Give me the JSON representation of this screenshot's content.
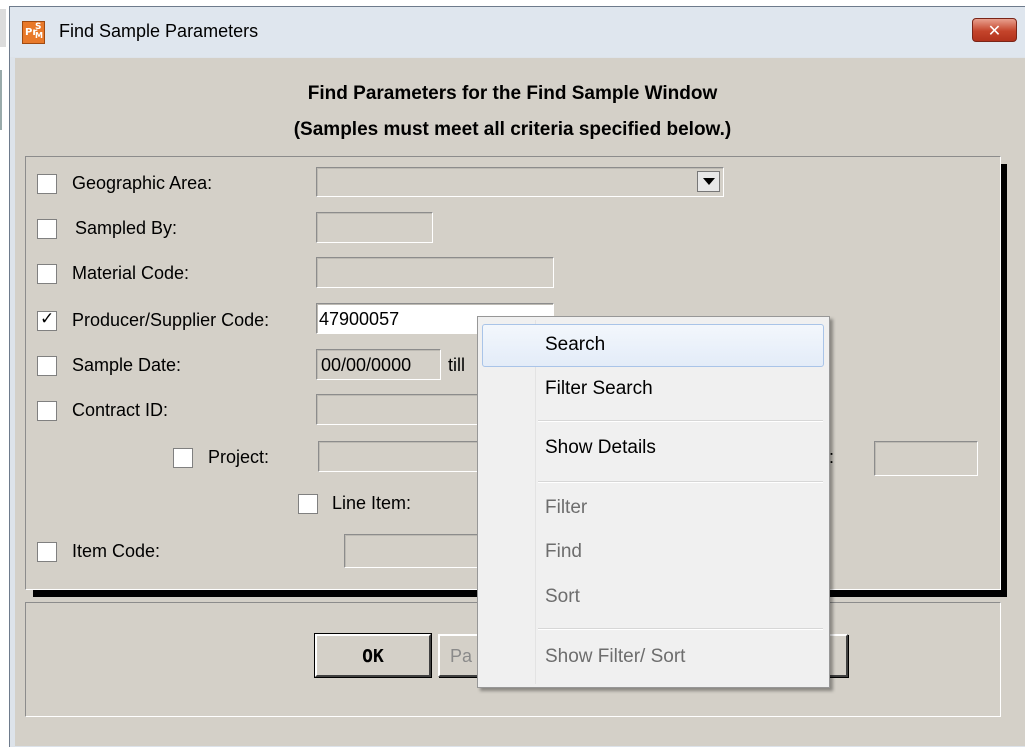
{
  "window": {
    "title": "Find Sample Parameters",
    "close_glyph": "✕",
    "icon": {
      "name": "prism-app-icon",
      "letters": [
        "Pr",
        "S",
        "M"
      ]
    }
  },
  "heading": {
    "line1": "Find Parameters for the Find Sample Window",
    "line2": "(Samples must meet all criteria specified below.)"
  },
  "criteria": {
    "geographic_area": {
      "label": "Geographic Area:",
      "checked": false,
      "value": ""
    },
    "sampled_by": {
      "label": "Sampled By:",
      "checked": false,
      "value": ""
    },
    "material_code": {
      "label": "Material Code:",
      "checked": false,
      "value": ""
    },
    "producer_supplier_code": {
      "label": "Producer/Supplier Code:",
      "checked": true,
      "value": "47900057"
    },
    "sample_date": {
      "label": "Sample Date:",
      "checked": false,
      "from": "00/00/0000",
      "till_label": "till"
    },
    "contract_id": {
      "label": "Contract ID:",
      "checked": false,
      "value": ""
    },
    "project": {
      "label": "Project:",
      "checked": false,
      "value": "",
      "partial_label": ":"
    },
    "line_item": {
      "label": "Line Item:",
      "checked": false
    },
    "item_code": {
      "label": "Item Code:",
      "checked": false,
      "value": ""
    }
  },
  "buttons": {
    "ok": "OK",
    "partial": "Pa"
  },
  "context_menu": {
    "items": [
      {
        "label": "Search",
        "enabled": true,
        "highlighted": true
      },
      {
        "label": "Filter Search",
        "enabled": true
      },
      {
        "label": "Show Details",
        "enabled": true
      },
      {
        "label": "Filter",
        "enabled": false
      },
      {
        "label": "Find",
        "enabled": false
      },
      {
        "label": "Sort",
        "enabled": false
      },
      {
        "label": "Show Filter/ Sort",
        "enabled": false
      }
    ]
  },
  "colors": {
    "dialog_bg": "#d4d0c8",
    "close_button": "#c4442b",
    "menu_highlight": "#e3ecf8"
  }
}
